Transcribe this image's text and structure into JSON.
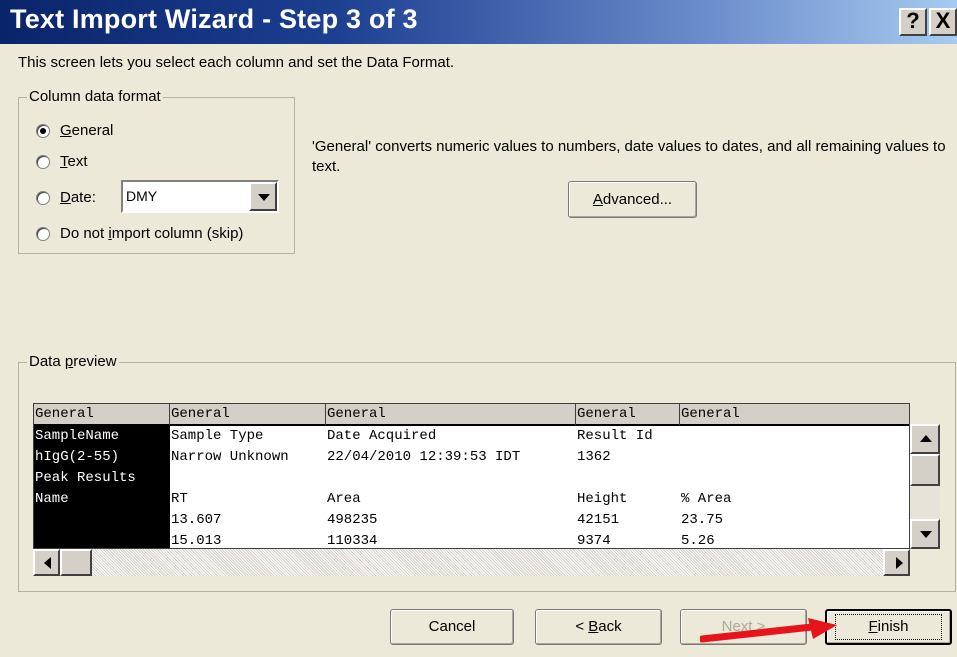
{
  "window": {
    "title": "Text Import Wizard - Step 3 of 3",
    "help_glyph": "?",
    "close_glyph": "X"
  },
  "instruction": "This screen lets you select each column and set the Data Format.",
  "column_format": {
    "legend": "Column data format",
    "options": [
      {
        "pre": "",
        "key": "G",
        "post": "eneral",
        "checked": true
      },
      {
        "pre": "",
        "key": "T",
        "post": "ext",
        "checked": false
      },
      {
        "pre": "",
        "key": "D",
        "post": "ate:",
        "checked": false
      },
      {
        "pre": "Do not ",
        "key": "i",
        "post": "mport column (skip)",
        "checked": false
      }
    ],
    "date_format": "DMY"
  },
  "description": "'General' converts numeric values to numbers, date values to dates, and all remaining values to text.",
  "advanced_button": {
    "key": "A",
    "post": "dvanced..."
  },
  "data_preview": {
    "legend_pre": "Data ",
    "legend_key": "p",
    "legend_post": "review",
    "columns": [
      {
        "header": "General",
        "cells": [
          "SampleName",
          "hIgG(2-55)",
          "Peak Results",
          "Name",
          "",
          ""
        ]
      },
      {
        "header": "General",
        "cells": [
          "Sample Type",
          "Narrow Unknown",
          "",
          "RT",
          "13.607",
          "15.013"
        ]
      },
      {
        "header": "General",
        "cells": [
          "Date Acquired",
          "22/04/2010 12:39:53 IDT",
          "",
          "Area",
          "498235",
          "110334"
        ]
      },
      {
        "header": "General",
        "cells": [
          "Result Id",
          "1362",
          "",
          "Height",
          "42151",
          "9374"
        ]
      },
      {
        "header": "General",
        "cells": [
          "",
          "",
          "",
          "% Area",
          "23.75",
          "5.26"
        ]
      }
    ]
  },
  "buttons": {
    "cancel": "Cancel",
    "back_pre": "< ",
    "back_key": "B",
    "back_post": "ack",
    "next": "Next >",
    "finish_key": "F",
    "finish_post": "inish"
  },
  "colors": {
    "accent_arrow": "#e8141c",
    "title_gradient_start": "#0a246a",
    "title_gradient_end": "#a6caf0"
  }
}
